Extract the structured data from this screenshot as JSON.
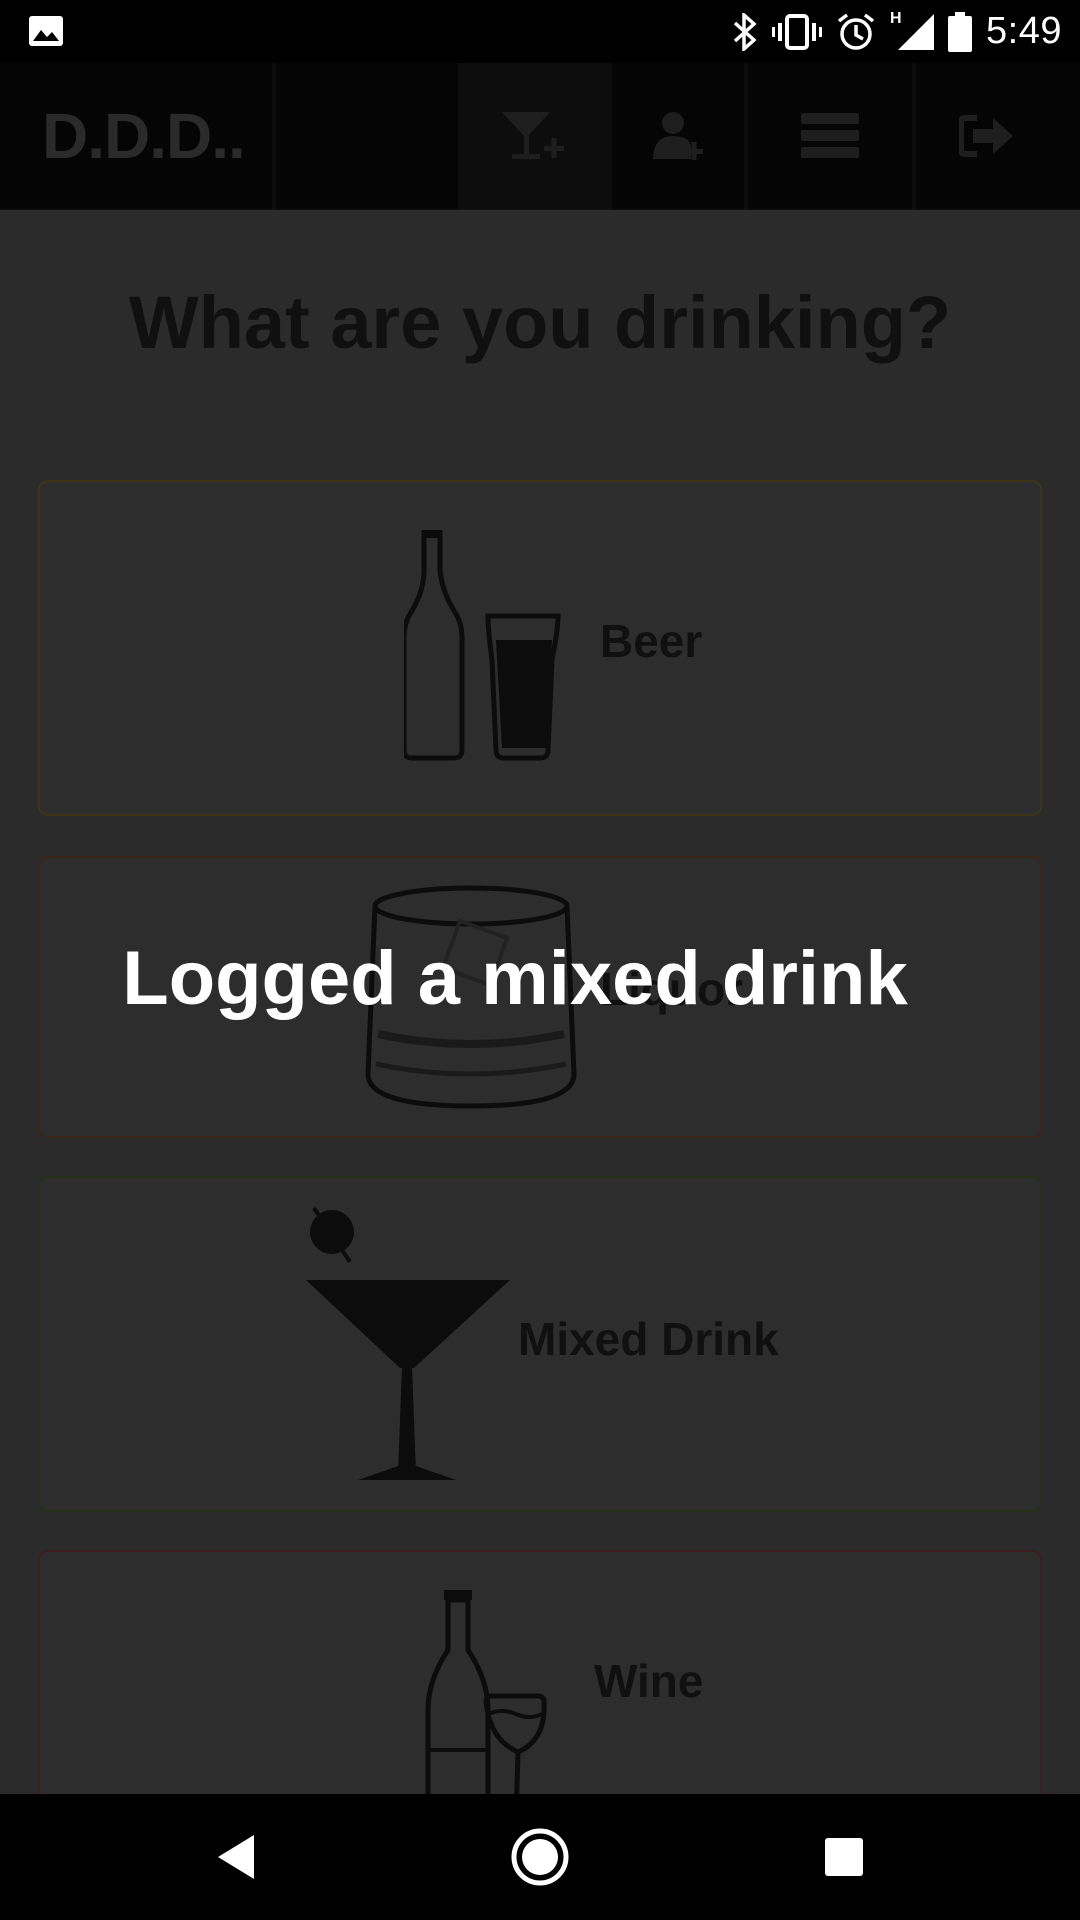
{
  "status_bar": {
    "time": "5:49",
    "network": "H",
    "icons": [
      "image-icon",
      "bluetooth-icon",
      "vibrate-icon",
      "alarm-icon",
      "signal-icon",
      "battery-icon"
    ]
  },
  "header": {
    "brand": "D.D.D..",
    "buttons": [
      {
        "name": "add-drink",
        "icon": "cocktail-plus-icon",
        "active": true
      },
      {
        "name": "add-user",
        "icon": "user-plus-icon",
        "active": false
      },
      {
        "name": "list",
        "icon": "list-icon",
        "active": false
      },
      {
        "name": "logout",
        "icon": "logout-icon",
        "active": false
      }
    ]
  },
  "main": {
    "title": "What are you drinking?",
    "options": [
      {
        "label": "Beer",
        "icon": "beer-icon"
      },
      {
        "label": "Liquor",
        "icon": "liquor-glass-icon"
      },
      {
        "label": "Mixed Drink",
        "icon": "martini-icon"
      },
      {
        "label": "Wine",
        "icon": "wine-icon"
      }
    ]
  },
  "toast": {
    "message": "Logged a mixed drink"
  },
  "colors": {
    "overlay_background": "#2b2b2b",
    "header_background": "#050505",
    "toast_text": "#ffffff"
  },
  "nav": {
    "back": "back-icon",
    "home": "home-icon",
    "recents": "recents-icon"
  }
}
